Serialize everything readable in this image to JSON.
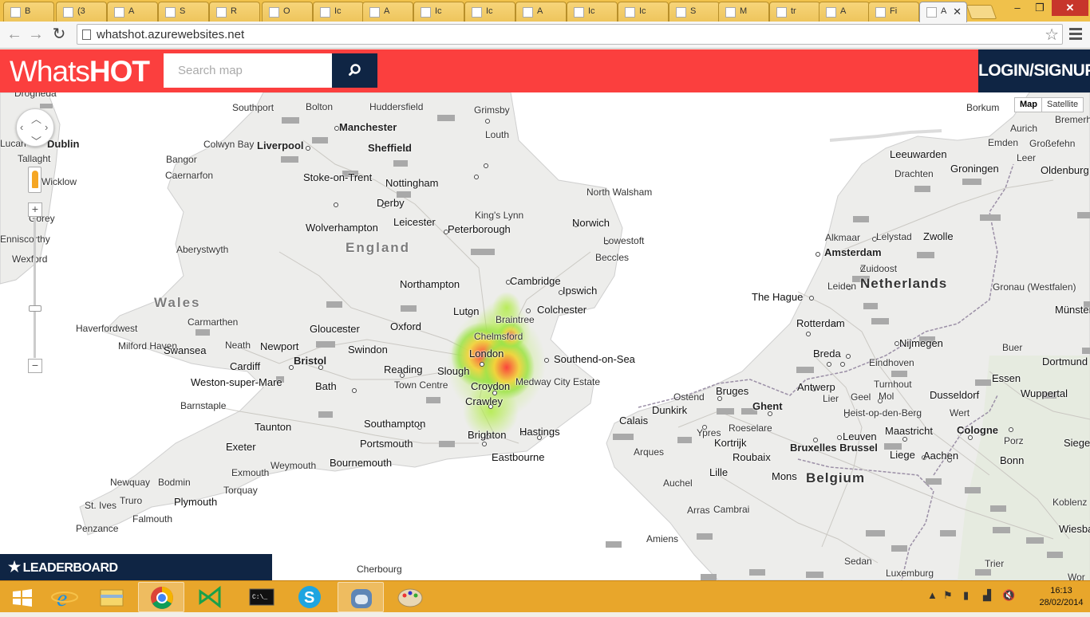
{
  "browser": {
    "tabs": [
      {
        "label": "B",
        "icon": "bbc-icon"
      },
      {
        "label": "(3",
        "icon": "twitter-icon"
      },
      {
        "label": "A",
        "icon": "page-icon"
      },
      {
        "label": "S",
        "icon": "windows-icon"
      },
      {
        "label": "R",
        "icon": "page-icon"
      },
      {
        "label": "O",
        "icon": "page-icon"
      },
      {
        "label": "Ic",
        "icon": "page-icon"
      },
      {
        "label": "A",
        "icon": "page-icon"
      },
      {
        "label": "Ic",
        "icon": "page-icon"
      },
      {
        "label": "Ic",
        "icon": "page-icon"
      },
      {
        "label": "A",
        "icon": "page-icon"
      },
      {
        "label": "Ic",
        "icon": "page-icon"
      },
      {
        "label": "Ic",
        "icon": "page-icon"
      },
      {
        "label": "S",
        "icon": "stackoverflow-icon"
      },
      {
        "label": "M",
        "icon": "maps-icon"
      },
      {
        "label": "tr",
        "icon": "google-icon"
      },
      {
        "label": "A",
        "icon": "page-icon"
      },
      {
        "label": "Fi",
        "icon": "wikipedia-icon"
      },
      {
        "label": "A",
        "icon": "page-icon"
      }
    ],
    "url": "whatshot.azurewebsites.net"
  },
  "app": {
    "logo_light": "Whats",
    "logo_bold": "HOT",
    "search_placeholder": "Search map",
    "login_label": "LOGIN/SIGNUP",
    "leaderboard_label": "LEADERBOARD",
    "brand_color": "#fb3f3e",
    "navy_color": "#0f2544"
  },
  "map": {
    "type_buttons": [
      "Map",
      "Satellite"
    ],
    "selected_type": "Map",
    "zoom_in": "+",
    "zoom_out": "−",
    "countries": [
      "England",
      "Wales",
      "Netherlands",
      "Belgium"
    ],
    "places": [
      {
        "name": "Southport"
      },
      {
        "name": "Bolton"
      },
      {
        "name": "Huddersfield"
      },
      {
        "name": "Grimsby"
      },
      {
        "name": "Manchester"
      },
      {
        "name": "Liverpool"
      },
      {
        "name": "Sheffield"
      },
      {
        "name": "Louth"
      },
      {
        "name": "Colwyn Bay"
      },
      {
        "name": "Bangor"
      },
      {
        "name": "Caernarfon"
      },
      {
        "name": "Stoke-on-Trent"
      },
      {
        "name": "Nottingham"
      },
      {
        "name": "Derby"
      },
      {
        "name": "North Walsham"
      },
      {
        "name": "King's Lynn"
      },
      {
        "name": "Norwich"
      },
      {
        "name": "Leicester"
      },
      {
        "name": "Wolverhampton"
      },
      {
        "name": "Peterborough"
      },
      {
        "name": "Lowestoft"
      },
      {
        "name": "Beccles"
      },
      {
        "name": "Aberystwyth"
      },
      {
        "name": "Northampton"
      },
      {
        "name": "Cambridge"
      },
      {
        "name": "Ipswich"
      },
      {
        "name": "Luton"
      },
      {
        "name": "Colchester"
      },
      {
        "name": "Braintree"
      },
      {
        "name": "Chelmsford"
      },
      {
        "name": "Haverfordwest"
      },
      {
        "name": "Carmarthen"
      },
      {
        "name": "Gloucester"
      },
      {
        "name": "Oxford"
      },
      {
        "name": "Milford Haven"
      },
      {
        "name": "Swansea"
      },
      {
        "name": "Neath"
      },
      {
        "name": "Newport"
      },
      {
        "name": "Swindon"
      },
      {
        "name": "London"
      },
      {
        "name": "Southend-on-Sea"
      },
      {
        "name": "Cardiff"
      },
      {
        "name": "Bristol"
      },
      {
        "name": "Reading"
      },
      {
        "name": "Slough"
      },
      {
        "name": "Weston-super-Mare"
      },
      {
        "name": "Bath"
      },
      {
        "name": "Town Centre"
      },
      {
        "name": "Croydon"
      },
      {
        "name": "Medway City Estate"
      },
      {
        "name": "Crawley"
      },
      {
        "name": "Barnstaple"
      },
      {
        "name": "Taunton"
      },
      {
        "name": "Southampton"
      },
      {
        "name": "Hastings"
      },
      {
        "name": "Portsmouth"
      },
      {
        "name": "Brighton"
      },
      {
        "name": "Exeter"
      },
      {
        "name": "Eastbourne"
      },
      {
        "name": "Weymouth"
      },
      {
        "name": "Bournemouth"
      },
      {
        "name": "Exmouth"
      },
      {
        "name": "Torquay"
      },
      {
        "name": "Newquay"
      },
      {
        "name": "Bodmin"
      },
      {
        "name": "Plymouth"
      },
      {
        "name": "Truro"
      },
      {
        "name": "St. Ives"
      },
      {
        "name": "Falmouth"
      },
      {
        "name": "Penzance"
      },
      {
        "name": "Cherbourg"
      },
      {
        "name": "Dublin"
      },
      {
        "name": "Tallaght"
      },
      {
        "name": "Wicklow"
      },
      {
        "name": "Gorey"
      },
      {
        "name": "Enniscorthy"
      },
      {
        "name": "Wexford"
      },
      {
        "name": "Lucan"
      },
      {
        "name": "Drogheda"
      },
      {
        "name": "Borkum"
      },
      {
        "name": "Bremerh"
      },
      {
        "name": "Aurich"
      },
      {
        "name": "Großefehn"
      },
      {
        "name": "Emden"
      },
      {
        "name": "Leer"
      },
      {
        "name": "Oldenburg"
      },
      {
        "name": "Leeuwarden"
      },
      {
        "name": "Drachten"
      },
      {
        "name": "Groningen"
      },
      {
        "name": "Alkmaar"
      },
      {
        "name": "Lelystad"
      },
      {
        "name": "Zwolle"
      },
      {
        "name": "Amsterdam"
      },
      {
        "name": "Zuidoost"
      },
      {
        "name": "Leiden"
      },
      {
        "name": "Gronau (Westfalen)"
      },
      {
        "name": "The Hague"
      },
      {
        "name": "Münster"
      },
      {
        "name": "Rotterdam"
      },
      {
        "name": "Nijmegen"
      },
      {
        "name": "Breda"
      },
      {
        "name": "Buer"
      },
      {
        "name": "Eindhoven"
      },
      {
        "name": "Dortmund"
      },
      {
        "name": "Essen"
      },
      {
        "name": "Ostend"
      },
      {
        "name": "Bruges"
      },
      {
        "name": "Antwerp"
      },
      {
        "name": "Turnhout"
      },
      {
        "name": "Lier"
      },
      {
        "name": "Geel"
      },
      {
        "name": "Mol"
      },
      {
        "name": "Dusseldorf"
      },
      {
        "name": "Wuppertal"
      },
      {
        "name": "Dunkirk"
      },
      {
        "name": "Ghent"
      },
      {
        "name": "Heist-op-den-Berg"
      },
      {
        "name": "Wert"
      },
      {
        "name": "Calais"
      },
      {
        "name": "Roeselare"
      },
      {
        "name": "Ypres"
      },
      {
        "name": "Maastricht"
      },
      {
        "name": "Cologne"
      },
      {
        "name": "Kortrijk"
      },
      {
        "name": "Leuven"
      },
      {
        "name": "Porz"
      },
      {
        "name": "Siege"
      },
      {
        "name": "Arques"
      },
      {
        "name": "Roubaix"
      },
      {
        "name": "Bruxelles Brussel"
      },
      {
        "name": "Liege"
      },
      {
        "name": "Aachen"
      },
      {
        "name": "Lille"
      },
      {
        "name": "Mons"
      },
      {
        "name": "Bonn"
      },
      {
        "name": "Auchel"
      },
      {
        "name": "Arras"
      },
      {
        "name": "Cambrai"
      },
      {
        "name": "Koblenz"
      },
      {
        "name": "Amiens"
      },
      {
        "name": "Wiesbaden"
      },
      {
        "name": "Sedan"
      },
      {
        "name": "Trier"
      },
      {
        "name": "Luxemburg"
      },
      {
        "name": "Wor"
      }
    ]
  },
  "taskbar": {
    "apps": [
      "start-icon",
      "ie-icon",
      "explorer-icon",
      "chrome-icon",
      "vs-icon",
      "cmd-icon",
      "skype-icon",
      "app-icon",
      "paint-icon"
    ],
    "time": "16:13",
    "date": "28/02/2014"
  }
}
